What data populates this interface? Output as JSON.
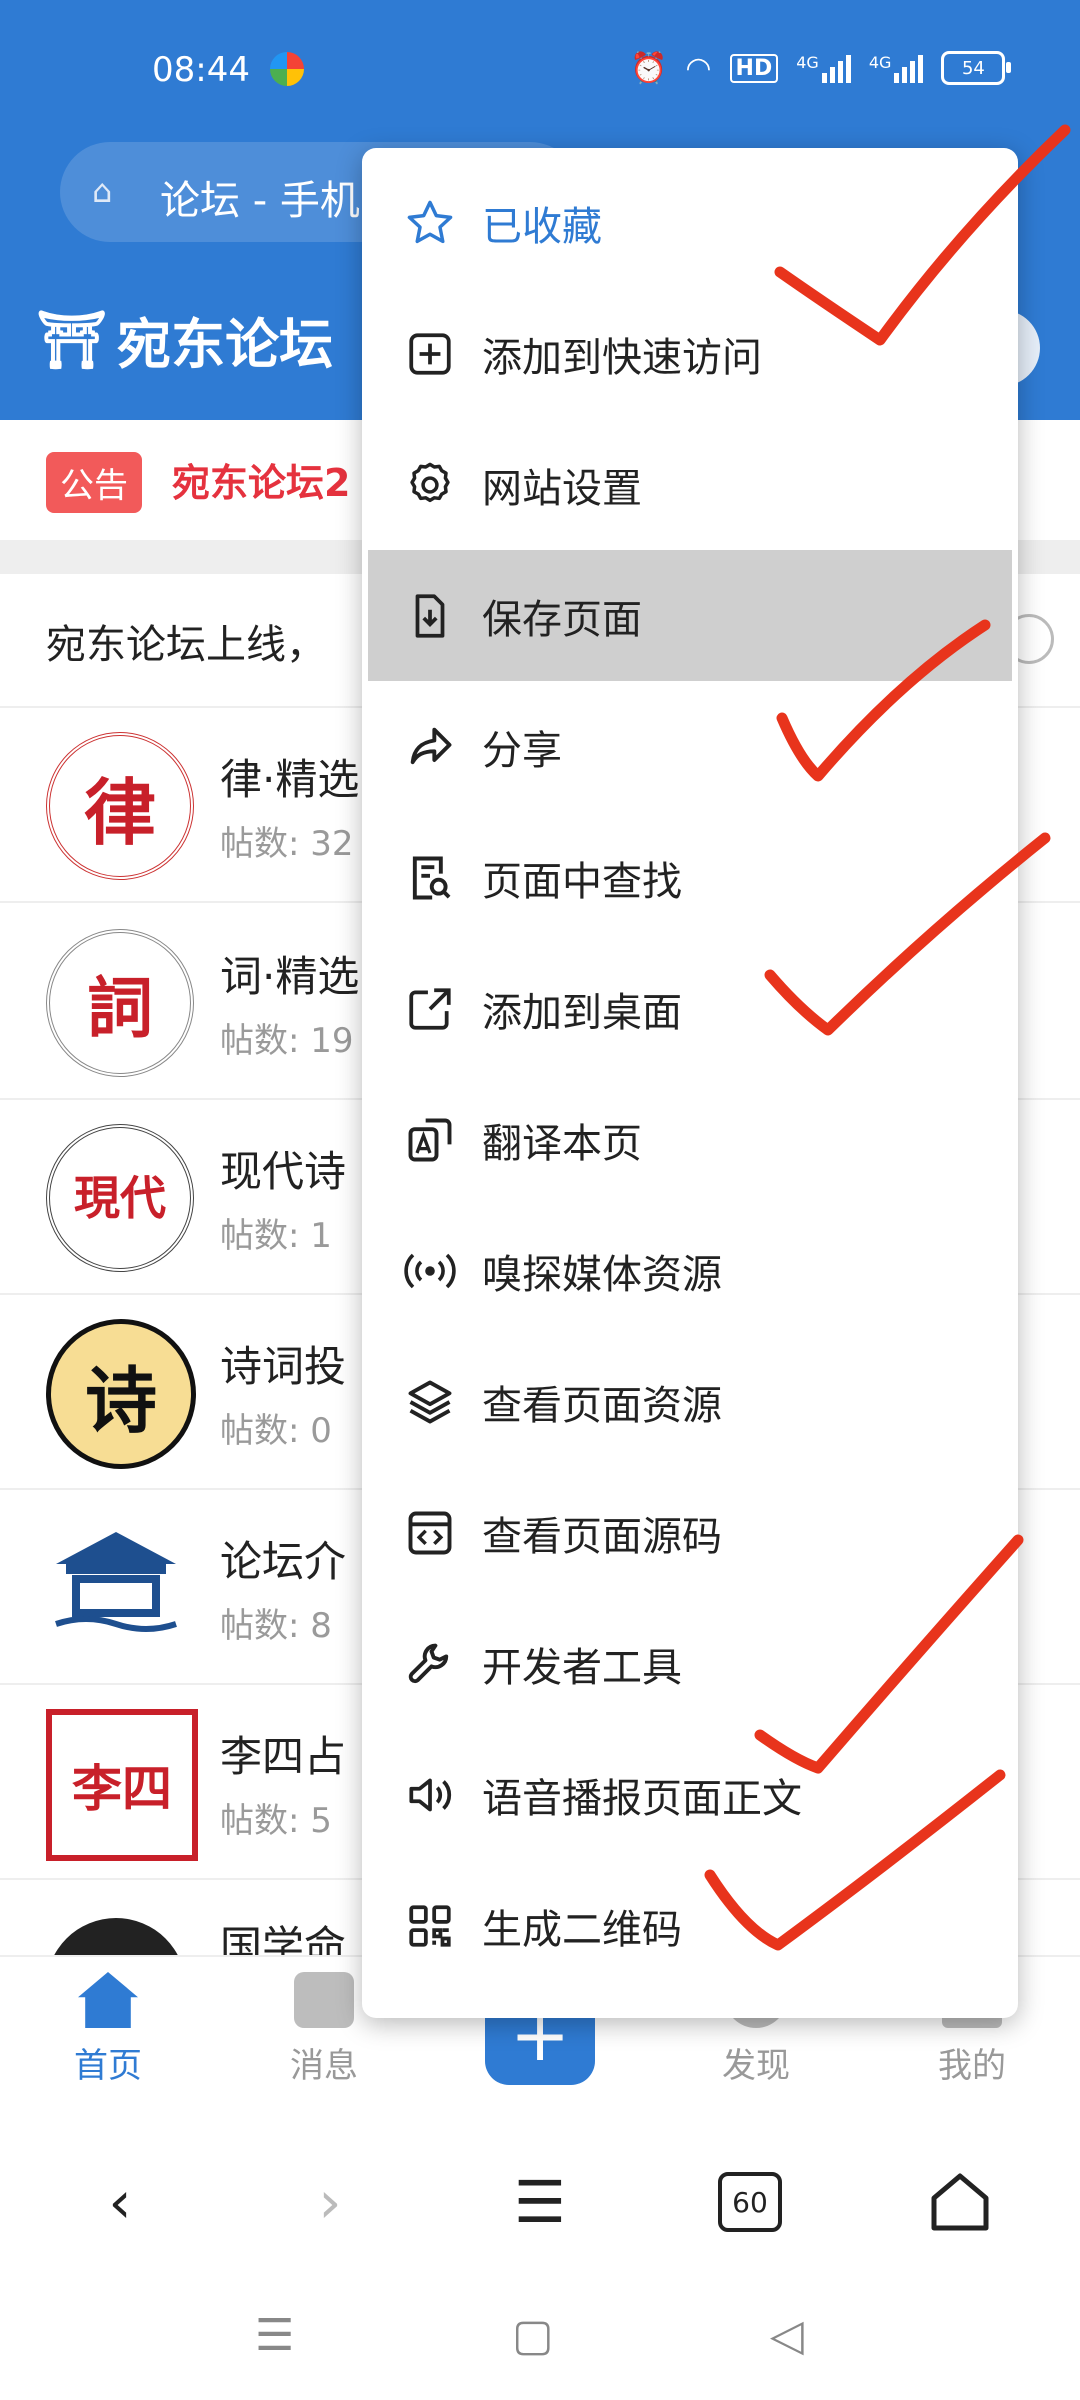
{
  "status_bar": {
    "time": "08:44",
    "network_left": "4G",
    "network_right": "4G",
    "battery": "54",
    "hd_label": "HD"
  },
  "address_bar": {
    "title": "论坛 - 手机"
  },
  "site": {
    "logo_text": "宛东论坛",
    "notice_badge": "公告",
    "notice_text": "宛东论坛2",
    "announcement": "宛东论坛上线，",
    "forums": [
      {
        "title": "律·精选",
        "meta": "帖数: 32",
        "avatar_text": "律"
      },
      {
        "title": "词·精选",
        "meta": "帖数: 19",
        "avatar_text": "詞"
      },
      {
        "title": "现代诗",
        "meta": "帖数: 1",
        "avatar_text": "現代"
      },
      {
        "title": "诗词投",
        "meta": "帖数: 0",
        "avatar_text": "诗"
      },
      {
        "title": "论坛介",
        "meta": "帖数: 8",
        "avatar_text": ""
      },
      {
        "title": "李四占",
        "meta": "帖数: 5",
        "avatar_text": "李四"
      },
      {
        "title": "国学命",
        "meta": "",
        "avatar_text": ""
      }
    ],
    "tabbar": {
      "home": "首页",
      "messages": "消息",
      "discover": "发现",
      "me": "我的",
      "plus": "+"
    }
  },
  "menu": {
    "items": [
      {
        "label": "已收藏",
        "icon": "star-icon",
        "active": true
      },
      {
        "label": "添加到快速访问",
        "icon": "plus-square-icon"
      },
      {
        "label": "网站设置",
        "icon": "gear-icon"
      },
      {
        "label": "保存页面",
        "icon": "save-file-icon",
        "highlighted": true
      },
      {
        "label": "分享",
        "icon": "share-icon"
      },
      {
        "label": "页面中查找",
        "icon": "find-in-page-icon"
      },
      {
        "label": "添加到桌面",
        "icon": "external-link-icon"
      },
      {
        "label": "翻译本页",
        "icon": "translate-icon"
      },
      {
        "label": "嗅探媒体资源",
        "icon": "broadcast-icon"
      },
      {
        "label": "查看页面资源",
        "icon": "layers-icon"
      },
      {
        "label": "查看页面源码",
        "icon": "code-icon"
      },
      {
        "label": "开发者工具",
        "icon": "wrench-icon"
      },
      {
        "label": "语音播报页面正文",
        "icon": "speaker-icon"
      },
      {
        "label": "生成二维码",
        "icon": "qr-code-icon"
      }
    ]
  },
  "browser_toolbar": {
    "tab_count": "60"
  },
  "colors": {
    "brand_blue": "#2f7bd3",
    "annotation_red": "#e8341c",
    "notice_red": "#e5323e"
  }
}
